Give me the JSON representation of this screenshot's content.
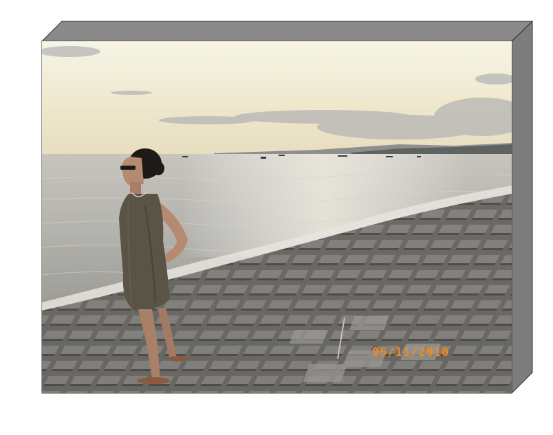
{
  "photo": {
    "date_stamp": "05/11/2010",
    "stamp_color": "#f08a1c",
    "subject": "woman-standing",
    "sky_colors": [
      "#f4f1dc",
      "#e9e2c7",
      "#c9c7c5"
    ],
    "sea_color": "#b8b8b4",
    "seawall_color": "#6e6c68"
  },
  "frame": {
    "face_top_color": "#8a8a8a",
    "face_side_color": "#7d7d7d",
    "edge_color": "#2f2f2f"
  }
}
